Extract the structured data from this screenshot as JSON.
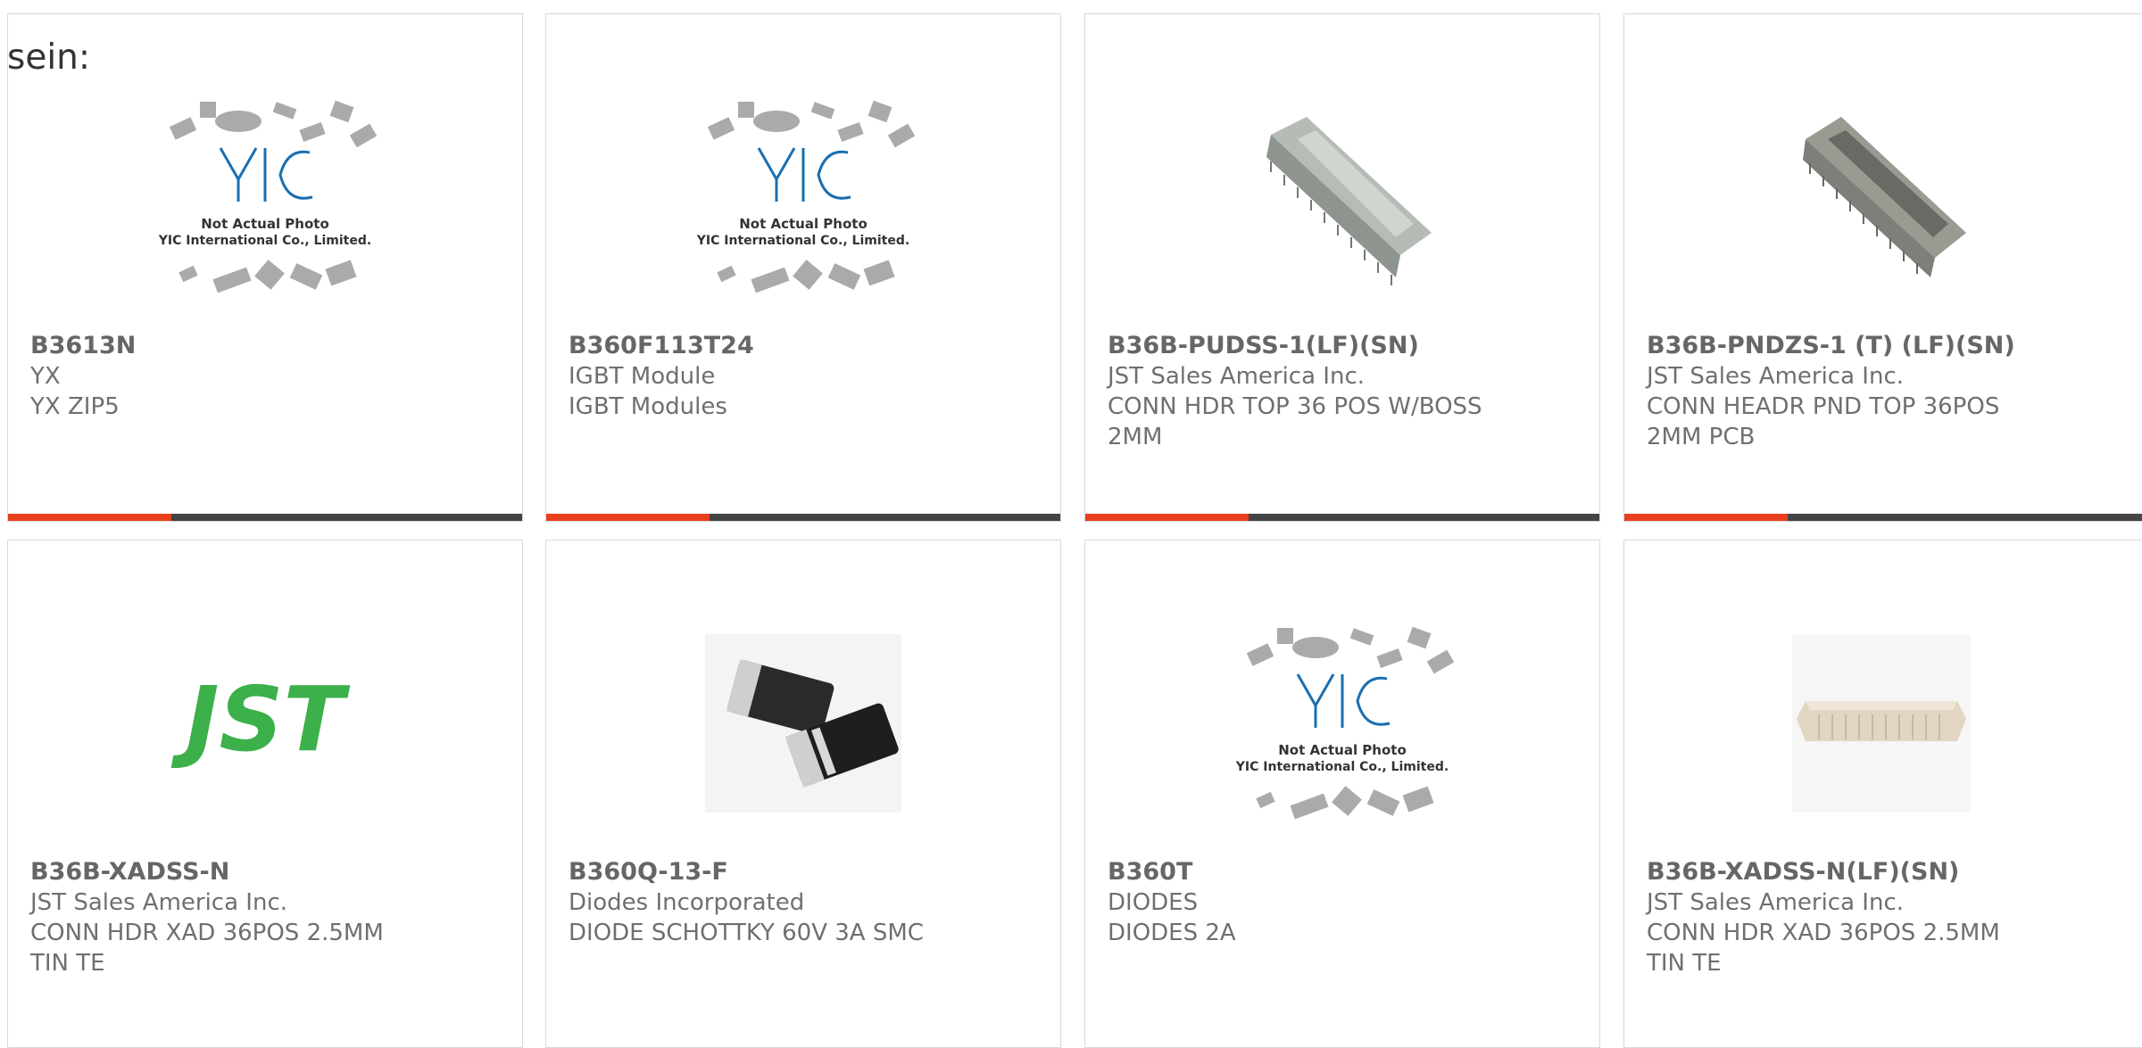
{
  "lead": "sein:",
  "colors": {
    "accent": "#e8401c",
    "bar": "#444444",
    "jst_green": "#3cb04a",
    "yic_blue": "#1a6fb0"
  },
  "products": [
    {
      "part": "B3613N",
      "manufacturer": "YX",
      "description": "YX ZIP5",
      "image": "yic-placeholder-image",
      "image_note": "Not Actual Photo",
      "image_company": "YIC International Co., Limited."
    },
    {
      "part": "B360F113T24",
      "manufacturer": "IGBT Module",
      "description": "IGBT Modules",
      "image": "yic-placeholder-image",
      "image_note": "Not Actual Photo",
      "image_company": "YIC International Co., Limited."
    },
    {
      "part": "B36B-PUDSS-1(LF)(SN)",
      "manufacturer": "JST Sales America Inc.",
      "description": "CONN HDR TOP 36 POS W/BOSS 2MM",
      "image": "connector-header-image"
    },
    {
      "part": "B36B-PNDZS-1 (T) (LF)(SN)",
      "manufacturer": "JST Sales America Inc.",
      "description": "CONN HEADR PND TOP 36POS 2MM PCB",
      "image": "connector-header-image"
    },
    {
      "part": "B36B-XADSS-N",
      "manufacturer": "JST Sales America Inc.",
      "description": "CONN HDR XAD 36POS 2.5MM TIN TE",
      "image": "jst-logo",
      "logo_text": "JST"
    },
    {
      "part": "B360Q-13-F",
      "manufacturer": "Diodes Incorporated",
      "description": "DIODE SCHOTTKY 60V 3A SMC",
      "image": "smc-diode-image"
    },
    {
      "part": "B360T",
      "manufacturer": "DIODES",
      "description": "DIODES 2A",
      "image": "yic-placeholder-image",
      "image_note": "Not Actual Photo",
      "image_company": "YIC International Co., Limited."
    },
    {
      "part": "B36B-XADSS-N(LF)(SN)",
      "manufacturer": "JST Sales America Inc.",
      "description": "CONN HDR XAD 36POS 2.5MM TIN TE",
      "image": "beige-connector-image"
    }
  ]
}
